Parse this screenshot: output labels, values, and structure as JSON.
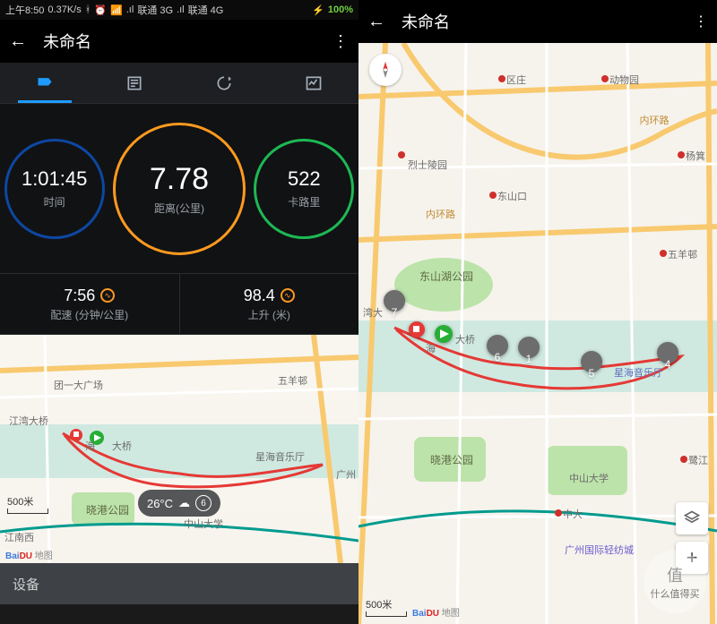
{
  "status": {
    "time": "上午8:50",
    "net": "0.37K/s",
    "carrier1": "联通 3G",
    "carrier2": "联通 4G",
    "battery": "100%"
  },
  "left": {
    "title": "未命名",
    "dials": {
      "duration": {
        "val": "1:01:45",
        "lab": "时间"
      },
      "distance": {
        "val": "7.78",
        "lab": "距离(公里)"
      },
      "calories": {
        "val": "522",
        "lab": "卡路里"
      }
    },
    "stats": {
      "pace": {
        "val": "7:56",
        "lab": "配速 (分钟/公里)"
      },
      "elev": {
        "val": "98.4",
        "lab": "上升 (米)"
      }
    },
    "weather": {
      "temp": "26°C",
      "day": "6"
    },
    "footer": "设备",
    "scale": "500米",
    "map_pois": [
      "团一大广场",
      "五羊邨",
      "江湾大桥",
      "海",
      "大桥",
      "晓港公园",
      "中山大学",
      "星海音乐厅",
      "广州",
      "江南西"
    ],
    "baidu": {
      "a": "Bai",
      "b": "DU",
      "c": "地图"
    }
  },
  "right": {
    "title": "未命名",
    "scale": "500米",
    "map_pois": [
      "区庄",
      "动物园",
      "烈士陵园",
      "东山口",
      "内环路",
      "内环路",
      "杨箕",
      "五羊邨",
      "湾大",
      "东山湖公园",
      "大桥",
      "海",
      "星海音乐厅",
      "晓港公园",
      "中山大学",
      "鹭江",
      "中大",
      "广州国际轻纺城"
    ],
    "km_markers": [
      "7",
      "6",
      "1",
      "5",
      "4"
    ],
    "baidu": {
      "a": "Bai",
      "b": "DU",
      "c": "地图"
    }
  },
  "watermark": {
    "v": "值",
    "t": "什么值得买"
  }
}
